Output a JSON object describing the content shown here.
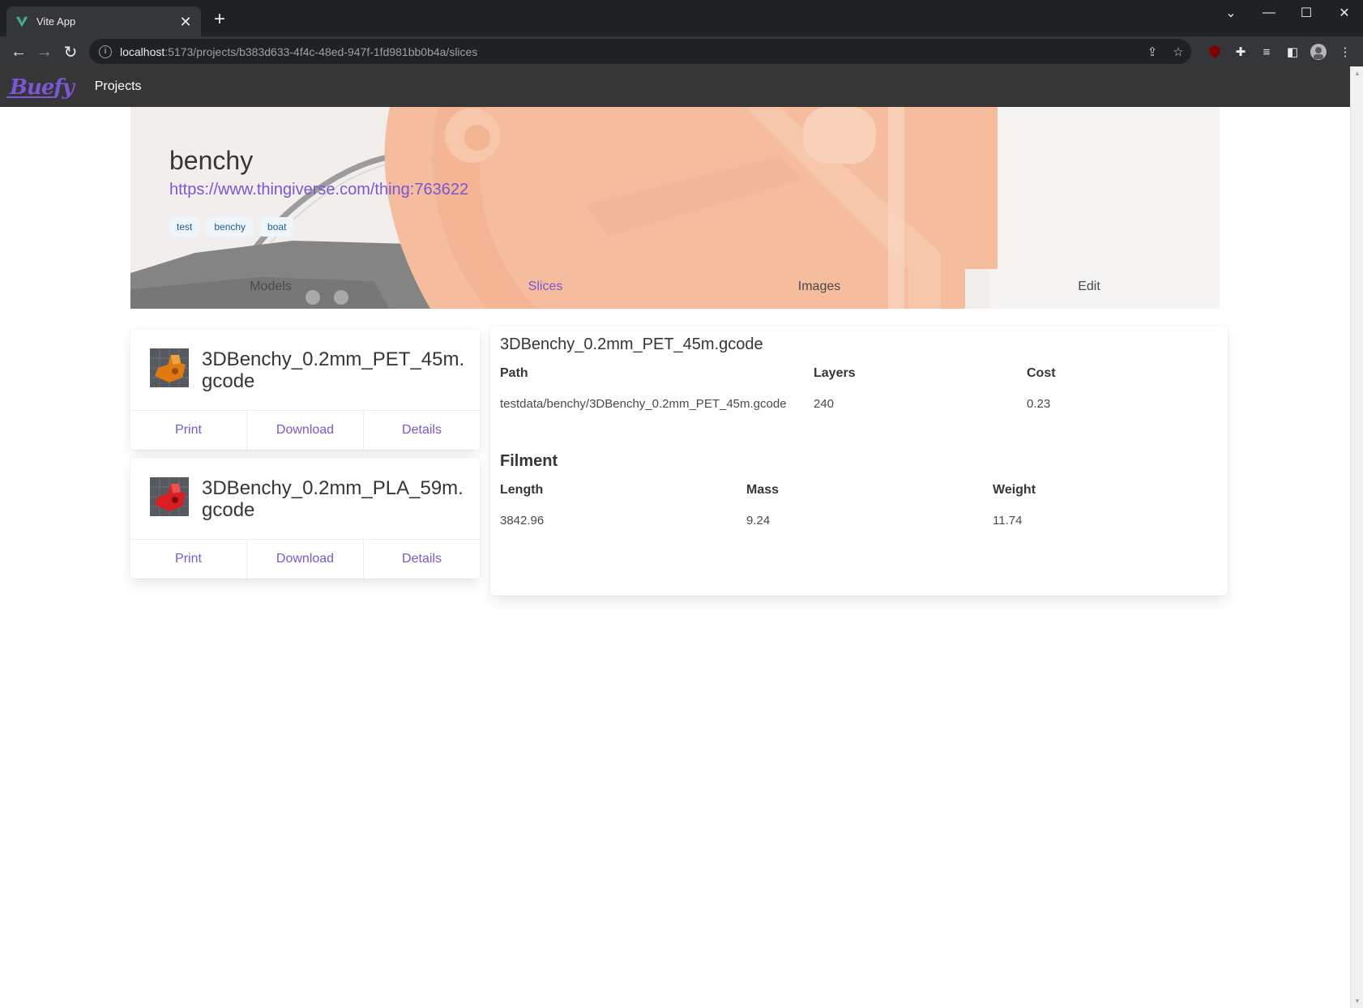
{
  "browser": {
    "tab_title": "Vite App",
    "url_host": "localhost",
    "url_path": ":5173/projects/b383d633-4f4c-48ed-947f-1fd981bb0b4a/slices"
  },
  "navbar": {
    "brand": "Buefy",
    "projects_label": "Projects"
  },
  "project": {
    "title": "benchy",
    "link": "https://www.thingiverse.com/thing:763622",
    "tags": [
      "test",
      "benchy",
      "boat"
    ],
    "tabs": [
      "Models",
      "Slices",
      "Images",
      "Edit"
    ],
    "active_tab": "Slices"
  },
  "slices": [
    {
      "name": "3DBenchy_0.2mm_PET_45m.\ngcode",
      "thumb_color": "#e07a10",
      "actions": [
        "Print",
        "Download",
        "Details"
      ]
    },
    {
      "name": "3DBenchy_0.2mm_PLA_59m.\ngcode",
      "thumb_color": "#d81e1e",
      "actions": [
        "Print",
        "Download",
        "Details"
      ]
    }
  ],
  "detail": {
    "title": "3DBenchy_0.2mm_PET_45m.gcode",
    "labels": {
      "path": "Path",
      "layers": "Layers",
      "cost": "Cost"
    },
    "path": "testdata/benchy/3DBenchy_0.2mm_PET_45m.gcode",
    "layers": "240",
    "cost": "0.23",
    "filament_title": "Filment",
    "filament_labels": {
      "length": "Length",
      "mass": "Mass",
      "weight": "Weight"
    },
    "length": "3842.96",
    "mass": "9.24",
    "weight": "11.74"
  },
  "colors": {
    "accent": "#7957d5",
    "navbar_bg": "#363636",
    "tag_bg": "#eef6fc",
    "tag_text": "#1d5d90"
  }
}
